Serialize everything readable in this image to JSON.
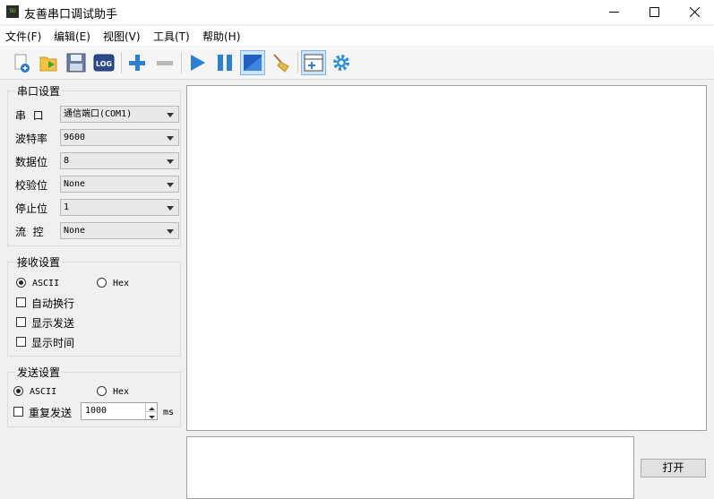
{
  "window": {
    "title": "友善串口调试助手",
    "icon_text": "SU",
    "icon_name": "app-logo-icon",
    "controls": [
      "minimize-icon",
      "maximize-icon",
      "close-icon"
    ]
  },
  "menu": {
    "items": [
      {
        "label": "文件(F)"
      },
      {
        "label": "编辑(E)"
      },
      {
        "label": "视图(V)"
      },
      {
        "label": "工具(T)"
      },
      {
        "label": "帮助(H)"
      }
    ]
  },
  "toolbar": {
    "icons": [
      "new-document-icon",
      "open-folder-icon",
      "save-icon",
      "log-icon",
      "add-icon",
      "remove-icon",
      "play-icon",
      "pause-icon",
      "window-icon",
      "broom-clear-icon",
      "layout-add-icon",
      "gear-icon"
    ],
    "log_label": "LOG"
  },
  "serial": {
    "title": "串口设置",
    "port_label": "串  口",
    "port_value": "通信端口(COM1)",
    "baud_label": "波特率",
    "baud_value": "9600",
    "databits_label": "数据位",
    "databits_value": "8",
    "parity_label": "校验位",
    "parity_value": "None",
    "stopbits_label": "停止位",
    "stopbits_value": "1",
    "flow_label": "流  控",
    "flow_value": "None"
  },
  "receive": {
    "title": "接收设置",
    "ascii_label": "ASCII",
    "hex_label": "Hex",
    "selected": "ASCII",
    "auto_wrap_label": "自动换行",
    "show_send_label": "显示发送",
    "show_time_label": "显示时间"
  },
  "send": {
    "title": "发送设置",
    "ascii_label": "ASCII",
    "hex_label": "Hex",
    "selected": "ASCII",
    "repeat_label": "重复发送",
    "repeat_interval": "1000",
    "unit": "ms",
    "open_button": "打开"
  }
}
